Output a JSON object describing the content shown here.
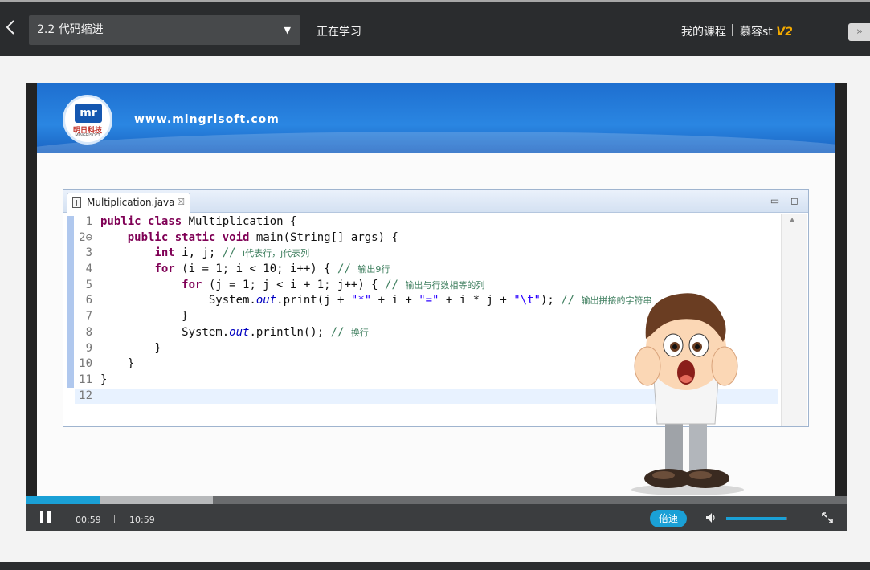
{
  "header": {
    "back_icon": "chevron-left-icon",
    "lesson": "2.2 代码缩进",
    "status": "正在学习",
    "my_courses": "我的课程",
    "brand_text": "慕容st",
    "brand_badge": "V2",
    "expand_label": "»"
  },
  "slide": {
    "site": "www.mingrisoft.com",
    "logo_mark": "mr",
    "logo_cn": "明日科技",
    "logo_en": "MINGRISOFT",
    "accent": "#1e6fd0"
  },
  "editor": {
    "tab_icon": "J",
    "tab_label": "Multiplication.java",
    "tab_close": "☒",
    "minimize": "▭",
    "maximize": "◻",
    "lines": [
      {
        "n": "1",
        "code": "public class Multiplication {"
      },
      {
        "n": "2⊖",
        "code": "    public static void main(String[] args) {"
      },
      {
        "n": "3",
        "code": "        int i, j; // i代表行，j代表列"
      },
      {
        "n": "4",
        "code": "        for (i = 1; i < 10; i++) { // 输出9行"
      },
      {
        "n": "5",
        "code": "            for (j = 1; j < i + 1; j++) { // 输出与行数相等的列"
      },
      {
        "n": "6",
        "code": "                System.out.print(j + \"*\" + i + \"=\" + i * j + \"\\t\"); // 输出拼接的字符串"
      },
      {
        "n": "7",
        "code": "            }"
      },
      {
        "n": "8",
        "code": "            System.out.println(); // 换行"
      },
      {
        "n": "9",
        "code": "        }"
      },
      {
        "n": "10",
        "code": "    }"
      },
      {
        "n": "11",
        "code": "}"
      },
      {
        "n": "12",
        "code": ""
      }
    ]
  },
  "player": {
    "current_time": "00:59",
    "duration": "10:59",
    "played_fraction": 0.09,
    "buffered_fraction": 0.228,
    "speed_label": "倍速",
    "volume_fraction": 0.98,
    "accent": "#1aa0d6",
    "pause_icon": "pause-icon",
    "volume_icon": "volume-icon",
    "fullscreen_icon": "fullscreen-icon"
  }
}
